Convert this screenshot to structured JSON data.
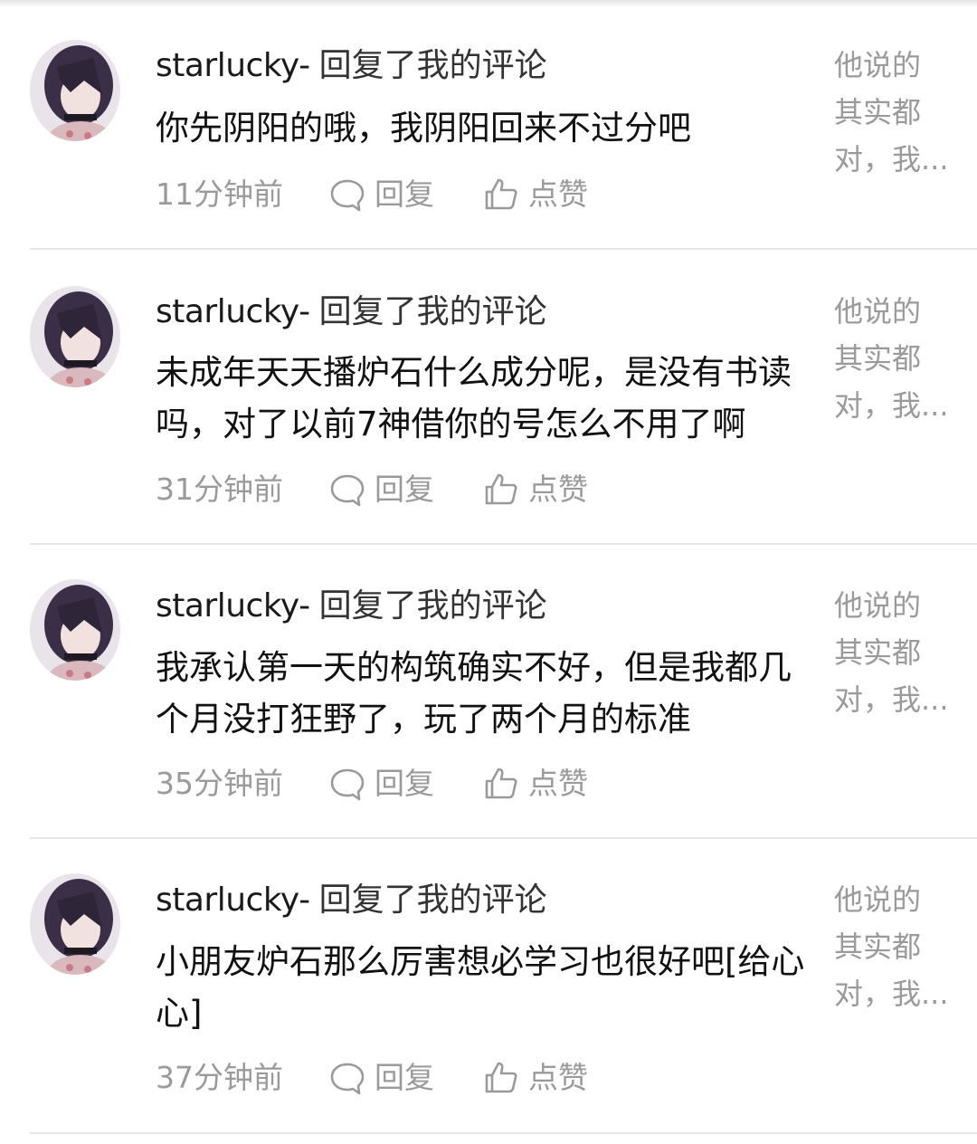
{
  "comments": [
    {
      "username": "starlucky-",
      "action": "回复了我的评论",
      "content": "你先阴阳的哦，我阴阳回来不过分吧",
      "time": "11分钟前",
      "reply_label": "回复",
      "like_label": "点赞",
      "snippet": [
        "他说的",
        "其实都",
        "对，我..."
      ]
    },
    {
      "username": "starlucky-",
      "action": "回复了我的评论",
      "content": "未成年天天播炉石什么成分呢，是没有书读吗，对了以前7神借你的号怎么不用了啊",
      "time": "31分钟前",
      "reply_label": "回复",
      "like_label": "点赞",
      "snippet": [
        "他说的",
        "其实都",
        "对，我..."
      ]
    },
    {
      "username": "starlucky-",
      "action": "回复了我的评论",
      "content": "我承认第一天的构筑确实不好，但是我都几个月没打狂野了，玩了两个月的标准",
      "time": "35分钟前",
      "reply_label": "回复",
      "like_label": "点赞",
      "snippet": [
        "他说的",
        "其实都",
        "对，我..."
      ]
    },
    {
      "username": "starlucky-",
      "action": "回复了我的评论",
      "content": "小朋友炉石那么厉害想必学习也很好吧[给心心]",
      "time": "37分钟前",
      "reply_label": "回复",
      "like_label": "点赞",
      "snippet": [
        "他说的",
        "其实都",
        "对，我..."
      ]
    }
  ],
  "colors": {
    "text": "#1a1a1a",
    "secondary": "#9a9a9a",
    "divider": "#e6e6e6"
  }
}
